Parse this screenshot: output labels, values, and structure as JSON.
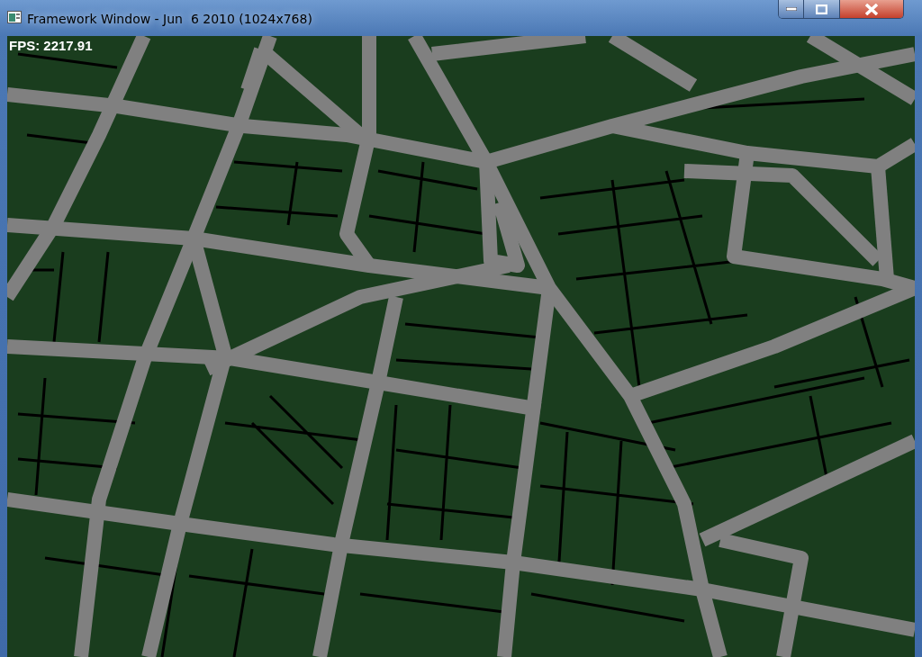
{
  "window": {
    "title": "Framework Window - Jun  6 2010 (1024x768)"
  },
  "viewport": {
    "fps_label": "FPS: 2217.91"
  }
}
